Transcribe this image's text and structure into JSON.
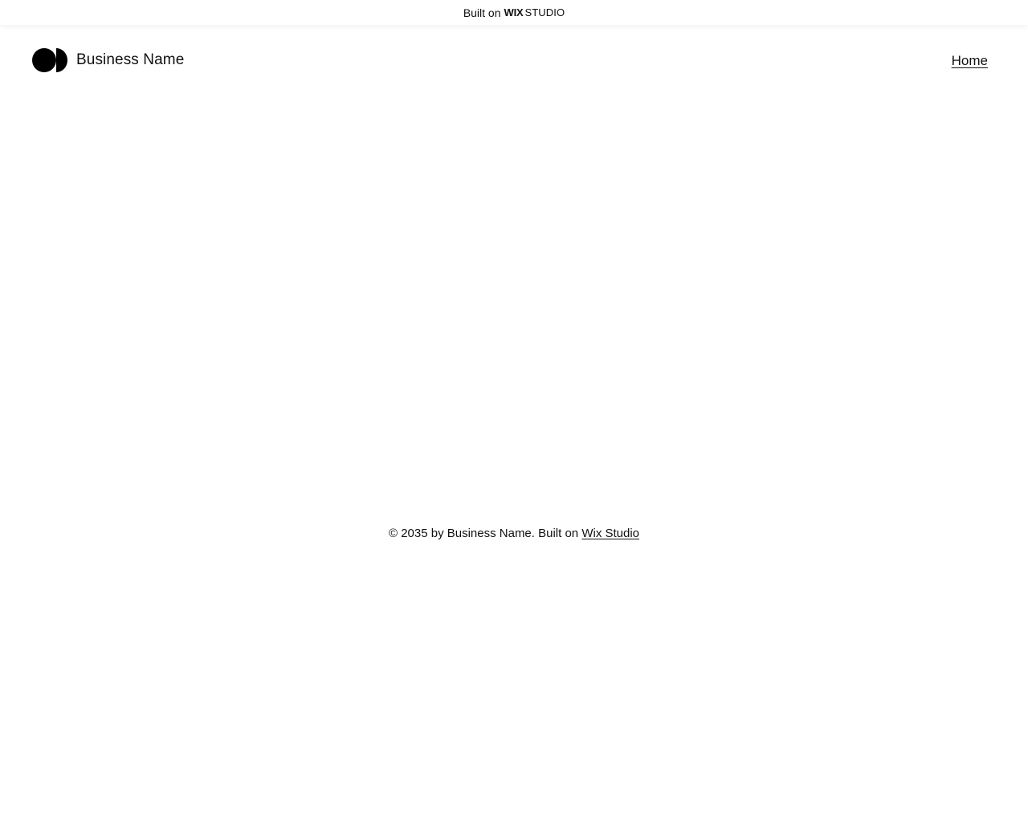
{
  "banner": {
    "built_on": "Built on",
    "brand_wix": "WIX",
    "brand_studio": "STUDIO"
  },
  "header": {
    "business_name": "Business Name",
    "logo_icon": "two-circles-logo-icon",
    "nav": [
      {
        "label": "Home"
      }
    ]
  },
  "footer": {
    "copyright_text": "© 2035 by Business Name. Built on ",
    "link_label": "Wix Studio"
  }
}
